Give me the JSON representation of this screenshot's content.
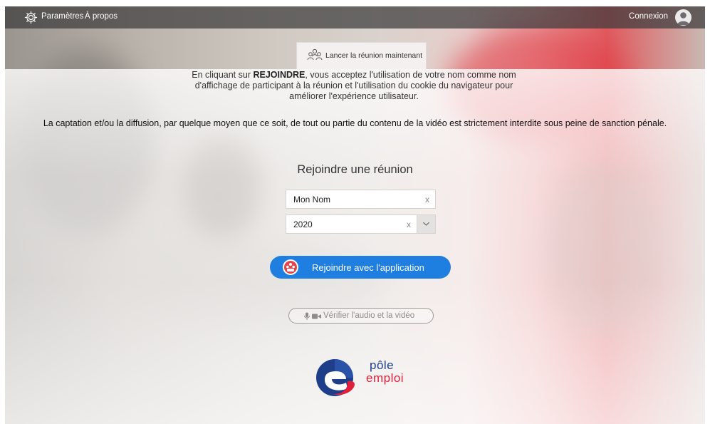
{
  "topbar": {
    "settings_label": "Paramètres",
    "about_label": "À propos",
    "login_label": "Connexion"
  },
  "launch_tab": {
    "label": "Lancer la réunion maintenant"
  },
  "consent": {
    "prefix": "En cliquant sur ",
    "keyword": "REJOINDRE",
    "suffix": ", vous acceptez l'utilisation de votre nom comme nom d'affichage de participant à la réunion et l'utilisation du cookie du navigateur pour améliorer l'expérience utilisateur."
  },
  "legal_notice": "La captation et/ou la diffusion, par quelque moyen que ce soit, de tout ou partie du contenu de la vidéo est strictement interdite sous peine de sanction pénale.",
  "join": {
    "title": "Rejoindre une réunion",
    "name_value": "Mon Nom",
    "meeting_id_value": "2020",
    "clear_glyph": "x",
    "join_button_label": "Rejoindre avec l'application",
    "av_check_label": "Vérifier l'audio et la vidéo"
  },
  "logo": {
    "word1": "pôle",
    "word2": "emploi"
  },
  "colors": {
    "primary_button": "#1e7fe0",
    "logo_blue": "#1f3e8a",
    "logo_red": "#e0203b",
    "topbar": "#3c3a3c"
  },
  "icons": {
    "settings": "gear-icon",
    "user": "user-avatar-icon",
    "group": "people-icon",
    "join_app": "meeting-app-icon",
    "av": "microphone-camera-icon",
    "dropdown": "chevron-down-icon"
  }
}
